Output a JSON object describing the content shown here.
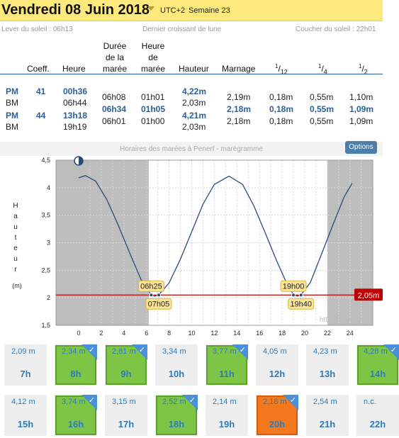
{
  "header": {
    "title": "Vendredi 08 Juin 2018",
    "timezone": "UTC+2",
    "week": "Semaine 23"
  },
  "sun": {
    "rise": "Lever du soleil : 06h13",
    "moon_phase": "Dernier croissant de lune",
    "set": "Coucher du soleil : 22h01"
  },
  "table": {
    "headers": {
      "coeff": "Coeff.",
      "heure": "Heure",
      "duree_l1": "Durée",
      "duree_l2": "de la",
      "duree_l3": "marée",
      "hmaree_l1": "Heure",
      "hmaree_l2": "de",
      "hmaree_l3": "marée",
      "hauteur": "Hauteur",
      "marnage": "Marnage",
      "f12": "1/12",
      "f4": "1/4",
      "f2": "1/2"
    },
    "labels": [
      "PM",
      "BM",
      "PM",
      "BM"
    ],
    "coeffs": [
      "41",
      "44"
    ],
    "heures": [
      "00h36",
      "06h44",
      "13h18",
      "19h19"
    ],
    "durees": [
      "06h08",
      "06h34",
      "06h01"
    ],
    "heures_maree": [
      "01h01",
      "01h05",
      "01h00"
    ],
    "hauteurs": [
      "4,22m",
      "2,03m",
      "4,21m",
      "2,03m"
    ],
    "marnages": [
      "2,19m",
      "2,18m",
      "2,18m"
    ],
    "douzieme": [
      "0,18m",
      "0,18m",
      "0,18m"
    ],
    "quart": [
      "0,55m",
      "0,55m",
      "0,55m"
    ],
    "demi": [
      "1,10m",
      "1,09m",
      "1,09m"
    ]
  },
  "chart_title": "Horaires des marées à Penerf - marégramme",
  "options_label": "Options",
  "chart_data": {
    "type": "line",
    "title": "Horaires des marées à Penerf - marégramme",
    "ylabel": "Hauteur (m)",
    "ylabel_letters": [
      "H",
      "a",
      "u",
      "t",
      "e",
      "u",
      "r"
    ],
    "yunit": "(m)",
    "xlim": [
      -2,
      25.5
    ],
    "ylim": [
      1.5,
      4.5
    ],
    "xticks": [
      0,
      2,
      4,
      6,
      8,
      10,
      12,
      14,
      16,
      18,
      20,
      22,
      24
    ],
    "yticks": [
      "1,5",
      "2",
      "2,5",
      "3",
      "3,5",
      "4",
      "4,5"
    ],
    "night_before": 6.2,
    "night_after": 22.0,
    "series": [
      {
        "x": [
          0,
          0.6,
          1.5,
          2.5,
          3.5,
          4.5,
          5.5,
          6.42,
          6.73,
          7.08,
          8,
          9,
          10,
          11,
          12,
          13.3,
          14.5,
          15.5,
          16.5,
          17.5,
          18.5,
          19.0,
          19.32,
          19.67,
          20.5,
          21.5,
          22.5,
          23.5,
          24.2
        ],
        "y": [
          4.18,
          4.22,
          4.12,
          3.78,
          3.32,
          2.82,
          2.34,
          2.05,
          2.03,
          2.05,
          2.27,
          2.7,
          3.2,
          3.7,
          4.06,
          4.21,
          4.06,
          3.67,
          3.18,
          2.68,
          2.22,
          2.06,
          2.03,
          2.05,
          2.28,
          2.8,
          3.33,
          3.84,
          4.08
        ]
      }
    ],
    "reference_line": {
      "value": 2.05,
      "label": "2,05m",
      "color": "#c00000"
    },
    "annotations": [
      {
        "label": "06h25",
        "x": 6.42,
        "pos": "above"
      },
      {
        "label": "07h05",
        "x": 7.08,
        "pos": "below"
      },
      {
        "label": "19h00",
        "x": 19.0,
        "pos": "above"
      },
      {
        "label": "19h40",
        "x": 19.67,
        "pos": "below"
      }
    ],
    "watermark": "http://maree.info",
    "colors": {
      "curve": "#2b4a7a",
      "night": "#bdbdbd",
      "grid": "#d8d8d8"
    }
  },
  "tiles": [
    {
      "height": "2,09 m",
      "hour": "7h",
      "state": "none"
    },
    {
      "height": "2,34 m",
      "hour": "8h",
      "state": "green"
    },
    {
      "height": "2,81 m",
      "hour": "9h",
      "state": "green"
    },
    {
      "height": "3,34 m",
      "hour": "10h",
      "state": "none"
    },
    {
      "height": "3,77 m",
      "hour": "11h",
      "state": "green"
    },
    {
      "height": "4,05 m",
      "hour": "12h",
      "state": "none"
    },
    {
      "height": "4,23 m",
      "hour": "13h",
      "state": "none"
    },
    {
      "height": "4,28 m",
      "hour": "14h",
      "state": "green"
    },
    {
      "height": "4,12 m",
      "hour": "15h",
      "state": "none"
    },
    {
      "height": "3,74 m",
      "hour": "16h",
      "state": "green"
    },
    {
      "height": "3,15 m",
      "hour": "17h",
      "state": "none"
    },
    {
      "height": "2,52 m",
      "hour": "18h",
      "state": "green"
    },
    {
      "height": "2,14 m",
      "hour": "19h",
      "state": "none"
    },
    {
      "height": "2,18 m",
      "hour": "20h",
      "state": "orange"
    },
    {
      "height": "2,54 m",
      "hour": "21h",
      "state": "none"
    },
    {
      "height": "n.c.",
      "hour": "22h",
      "state": "none"
    }
  ],
  "check_glyph": "✓"
}
